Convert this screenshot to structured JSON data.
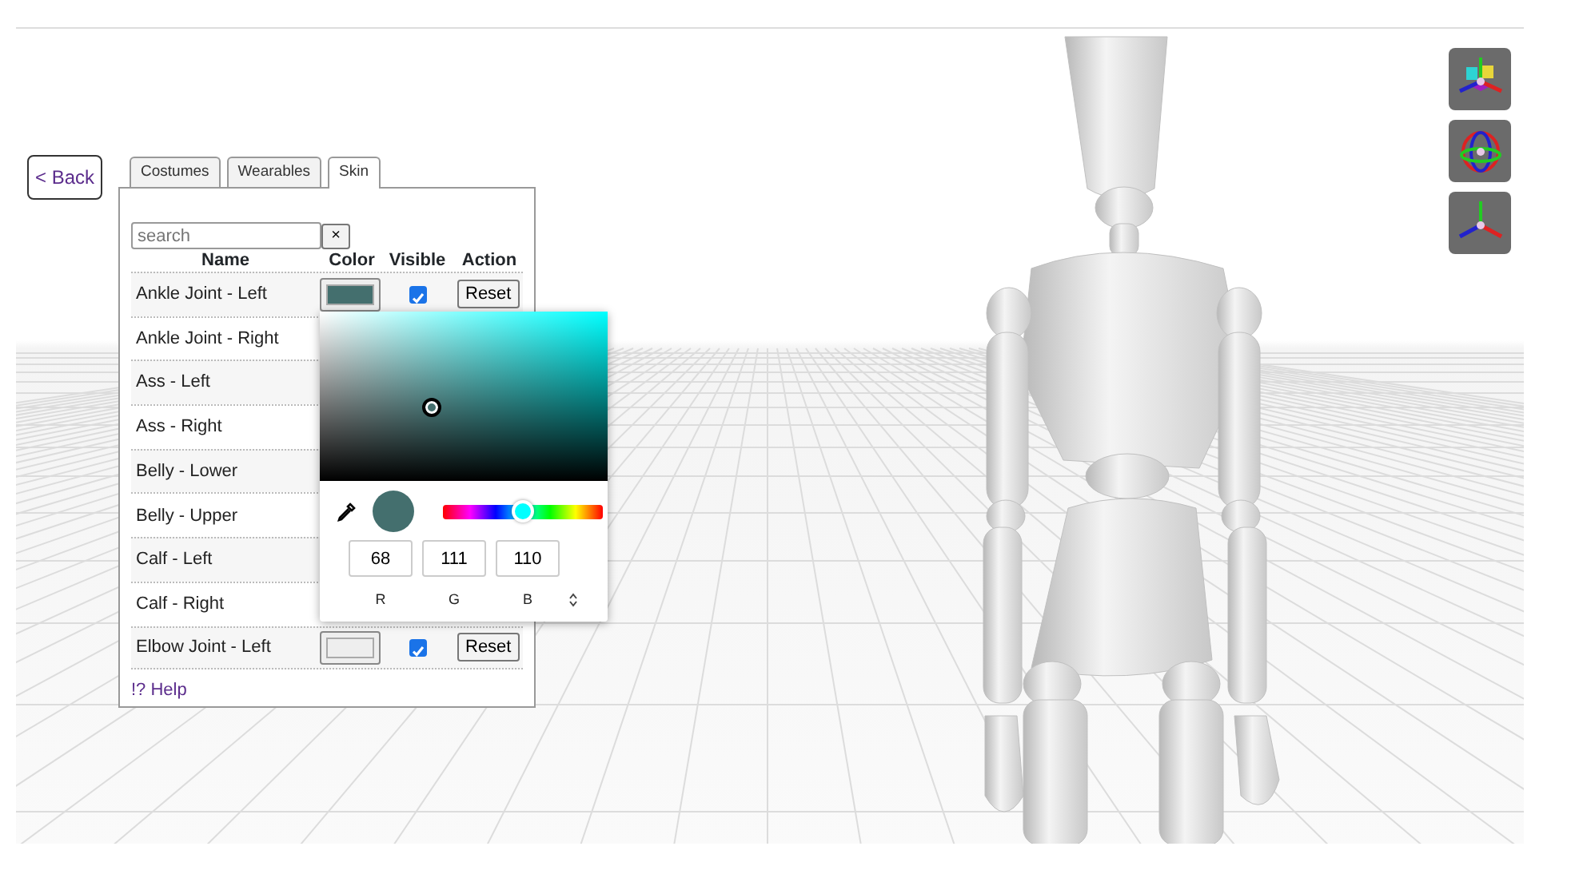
{
  "back_button": {
    "label": "< Back"
  },
  "tabs": [
    {
      "label": "Costumes",
      "selected": false
    },
    {
      "label": "Wearables",
      "selected": false
    },
    {
      "label": "Skin",
      "selected": true
    }
  ],
  "search": {
    "placeholder": "search",
    "clear_label": "×"
  },
  "table": {
    "columns": [
      "Name",
      "Color",
      "Visible",
      "Action"
    ],
    "rows": [
      {
        "name": "Ankle Joint - Left",
        "color": "#446f6e",
        "visible": true,
        "action": "Reset"
      },
      {
        "name": "Ankle Joint - Right"
      },
      {
        "name": "Ass - Left"
      },
      {
        "name": "Ass - Right"
      },
      {
        "name": "Belly - Lower"
      },
      {
        "name": "Belly - Upper"
      },
      {
        "name": "Calf - Left"
      },
      {
        "name": "Calf - Right"
      },
      {
        "name": "Elbow Joint - Left",
        "color": "#eeeeee",
        "visible": true,
        "action": "Reset"
      }
    ]
  },
  "help_link": "!? Help",
  "color_picker": {
    "color": "#446f6e",
    "hue_slider": {
      "level": 0.5
    },
    "fields": [
      {
        "value": "68",
        "label": "R"
      },
      {
        "value": "111",
        "label": "G"
      },
      {
        "value": "110",
        "label": "B"
      }
    ]
  },
  "gizmo_buttons": [
    {
      "kind": "scale"
    },
    {
      "kind": "rotate"
    },
    {
      "kind": "translate"
    }
  ]
}
